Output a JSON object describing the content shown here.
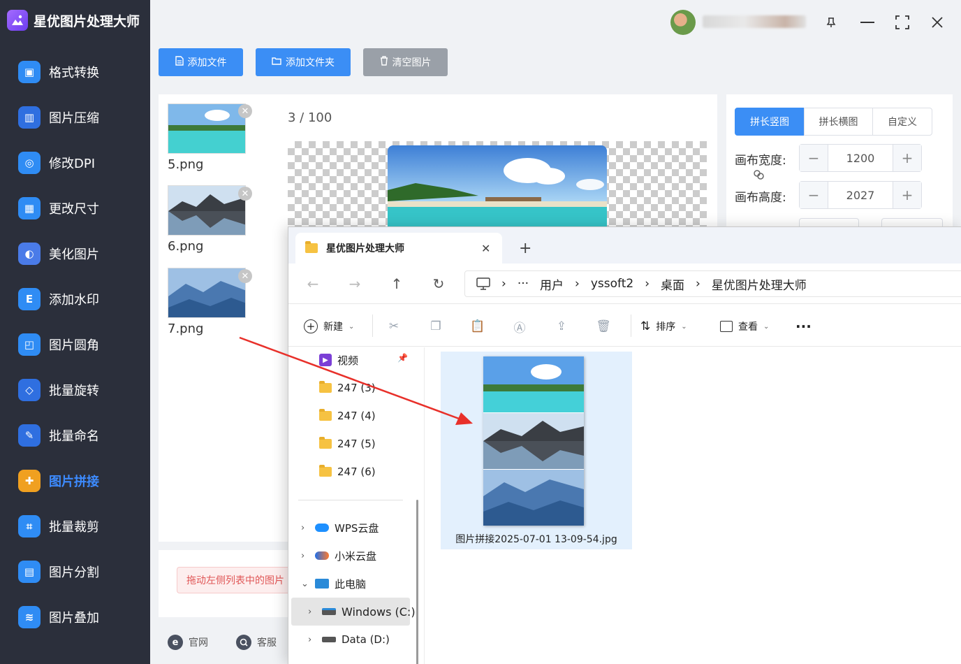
{
  "app": {
    "title": "星优图片处理大师"
  },
  "sidebar": {
    "items": [
      {
        "label": "格式转换",
        "icon": "image-convert-icon",
        "color": "#2f8cf4"
      },
      {
        "label": "图片压缩",
        "icon": "compress-icon",
        "color": "#2f6fe0"
      },
      {
        "label": "修改DPI",
        "icon": "dpi-icon",
        "color": "#2f8cf4"
      },
      {
        "label": "更改尺寸",
        "icon": "resize-icon",
        "color": "#2f8cf4"
      },
      {
        "label": "美化图片",
        "icon": "beautify-icon",
        "color": "#4a7be8"
      },
      {
        "label": "添加水印",
        "icon": "watermark-icon",
        "color": "#2f8cf4"
      },
      {
        "label": "图片圆角",
        "icon": "round-corner-icon",
        "color": "#2f8cf4"
      },
      {
        "label": "批量旋转",
        "icon": "rotate-icon",
        "color": "#2f6fe0"
      },
      {
        "label": "批量命名",
        "icon": "rename-icon",
        "color": "#2f6fe0"
      },
      {
        "label": "图片拼接",
        "icon": "puzzle-icon",
        "color": "#f0a020"
      },
      {
        "label": "批量裁剪",
        "icon": "crop-icon",
        "color": "#2f8cf4"
      },
      {
        "label": "图片分割",
        "icon": "split-icon",
        "color": "#2f8cf4"
      },
      {
        "label": "图片叠加",
        "icon": "layers-icon",
        "color": "#2f8cf4"
      }
    ],
    "active_label": "图片拼接"
  },
  "toolbar": {
    "add_file": "添加文件",
    "add_folder": "添加文件夹",
    "clear": "清空图片"
  },
  "file_list": {
    "items": [
      {
        "name": "5.png"
      },
      {
        "name": "6.png"
      },
      {
        "name": "7.png"
      }
    ]
  },
  "preview": {
    "count": "3",
    "separator": " / ",
    "max": "100"
  },
  "hint": {
    "text": "拖动左侧列表中的图片"
  },
  "footer": {
    "website": "官网",
    "support": "客服"
  },
  "settings": {
    "modes": [
      "拼长竖图",
      "拼长横图",
      "自定义"
    ],
    "active_mode": "拼长竖图",
    "width_label": "画布宽度:",
    "width_value": "1200",
    "height_label": "画布高度:",
    "height_value": "2027"
  },
  "explorer": {
    "tab_title": "星优图片处理大师",
    "breadcrumb": [
      "用户",
      "yssoft2",
      "桌面",
      "星优图片处理大师"
    ],
    "commands": {
      "new": "新建",
      "sort": "排序",
      "view": "查看"
    },
    "quick_access": [
      {
        "label": "视频",
        "type": "video"
      },
      {
        "label": "247 (3)",
        "type": "folder"
      },
      {
        "label": "247 (4)",
        "type": "folder"
      },
      {
        "label": "247 (5)",
        "type": "folder"
      },
      {
        "label": "247 (6)",
        "type": "folder"
      }
    ],
    "drives_tree": [
      {
        "label": "WPS云盘",
        "expanded": false
      },
      {
        "label": "小米云盘",
        "expanded": false
      },
      {
        "label": "此电脑",
        "expanded": true
      },
      {
        "label": "Windows (C:)",
        "expanded": false,
        "selected": true
      },
      {
        "label": "Data (D:)",
        "expanded": false
      }
    ],
    "file": {
      "name": "图片拼接2025-07-01 13-09-54.jpg"
    }
  },
  "colors": {
    "accent": "#3b8ef5",
    "sidebar_bg": "#2b2f3b",
    "arrow": "#e8302a"
  }
}
